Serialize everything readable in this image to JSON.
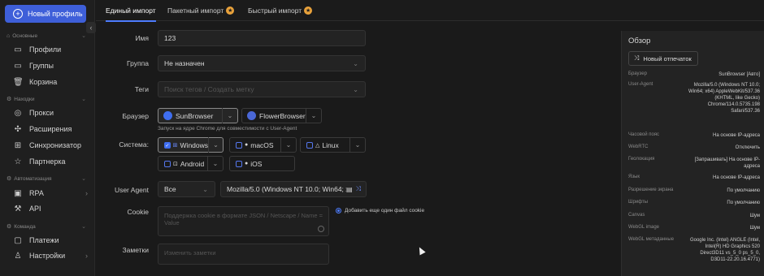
{
  "sidebar": {
    "new_profile": "Новый профиль",
    "sections": [
      {
        "title": "Основные",
        "items": [
          {
            "label": "Профили",
            "icon": "folder-icon"
          },
          {
            "label": "Группы",
            "icon": "folder-group-icon"
          },
          {
            "label": "Корзина",
            "icon": "trash-icon"
          }
        ]
      },
      {
        "title": "Находки",
        "items": [
          {
            "label": "Прокси",
            "icon": "globe-icon"
          },
          {
            "label": "Расширения",
            "icon": "puzzle-icon"
          },
          {
            "label": "Синхронизатор",
            "icon": "sync-icon"
          },
          {
            "label": "Партнерка",
            "icon": "star-icon"
          }
        ]
      },
      {
        "title": "Автоматизация",
        "items": [
          {
            "label": "RPA",
            "icon": "rpa-icon"
          },
          {
            "label": "API",
            "icon": "api-icon"
          }
        ]
      },
      {
        "title": "Команда",
        "items": [
          {
            "label": "Платежи",
            "icon": "payment-icon"
          },
          {
            "label": "Настройки",
            "icon": "users-settings-icon"
          }
        ]
      }
    ]
  },
  "tabs": [
    {
      "label": "Единый импорт",
      "active": true
    },
    {
      "label": "Пакетный импорт",
      "badge": true
    },
    {
      "label": "Быстрый импорт",
      "badge": true
    }
  ],
  "form": {
    "name_label": "Имя",
    "name_value": "123",
    "group_label": "Группа",
    "group_value": "Не назначен",
    "tags_label": "Теги",
    "tags_placeholder": "Поиск тегов / Создать метку",
    "browser_label": "Браузер",
    "browser_options": [
      "SunBrowser",
      "FlowerBrowser"
    ],
    "browser_hint": "Запуск на ядре Chrome для совместимости с User-Agent",
    "system_label": "Система:",
    "systems": [
      {
        "label": "Windows",
        "checked": true
      },
      {
        "label": "macOS"
      },
      {
        "label": "Linux"
      },
      {
        "label": "Android"
      },
      {
        "label": "iOS"
      }
    ],
    "ua_label": "User Agent",
    "ua_mode": "Все",
    "ua_value": "Mozilla/5.0 (Windows NT 10.0; Win64; x...",
    "cookie_label": "Cookie",
    "cookie_placeholder": "Поддержка cookie в формате JSON / Netscape / Name = Value",
    "cookie_option": "Добавить еще один файл cookie",
    "notes_label": "Заметки",
    "notes_placeholder": "Изменить заметки"
  },
  "overview": {
    "title": "Обзор",
    "fingerprint_button": "Новый отпечаток",
    "rows": [
      {
        "k": "Браузер",
        "v": "SunBrowser [Авто]"
      },
      {
        "k": "User-Agent",
        "v": "Mozilla/5.0 (Windows NT 10.0; Win64; x64) AppleWebKit/537.36 (KHTML, like Gecko) Chrome/114.0.5735.198 Safari/537.36"
      },
      {
        "k": "Часовой пояс",
        "v": "На основе IP-адреса"
      },
      {
        "k": "WebRTC",
        "v": "Отключить"
      },
      {
        "k": "Геолокация",
        "v": "[Запрашивать] На основе IP-адреса"
      },
      {
        "k": "Язык",
        "v": "На основе IP-адреса"
      },
      {
        "k": "Разрешение экрана",
        "v": "По умолчанию"
      },
      {
        "k": "Шрифты",
        "v": "По умолчанию"
      },
      {
        "k": "Canvas",
        "v": "Шум"
      },
      {
        "k": "WebGL image",
        "v": "Шум"
      },
      {
        "k": "WebGL метаданные",
        "v": "Google Inc. (Intel) ANGLE (Intel, Intel(R) HD Graphics 520 Direct3D11 vs_5_0 ps_5_0, D3D11-22.20.16.4771)"
      }
    ]
  },
  "colors": {
    "accent": "#3e5fd9",
    "background": "#1a1a1a"
  }
}
